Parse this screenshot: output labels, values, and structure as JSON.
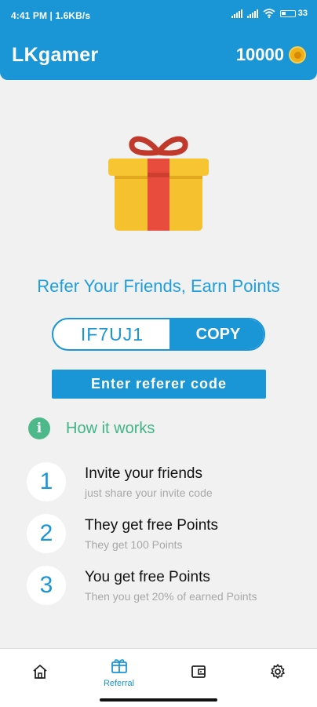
{
  "status_bar": {
    "time": "4:41 PM | 1.6KB/s",
    "battery": "33"
  },
  "app_bar": {
    "title": "LKgamer",
    "points": "10000",
    "coin_icon": "coin-icon"
  },
  "referral": {
    "headline": "Refer Your Friends, Earn Points",
    "code": "IF7UJ1",
    "copy_label": "COPY",
    "enter_referer_label": "Enter referer code"
  },
  "how_it_works": {
    "label": "How it works",
    "steps": [
      {
        "number": "1",
        "title": "Invite your friends",
        "subtitle": "just share your invite code"
      },
      {
        "number": "2",
        "title": "They get free Points",
        "subtitle": "They get 100 Points"
      },
      {
        "number": "3",
        "title": "You get free Points",
        "subtitle": "Then you get 20% of earned Points"
      }
    ]
  },
  "bottom_nav": {
    "items": [
      {
        "icon": "home-icon",
        "label": ""
      },
      {
        "icon": "referral-icon",
        "label": "Referral"
      },
      {
        "icon": "wallet-icon",
        "label": ""
      },
      {
        "icon": "settings-icon",
        "label": ""
      }
    ],
    "active_color": "#1a95d6"
  },
  "colors": {
    "primary": "#1a95d6",
    "accent_green": "#4db88a",
    "background": "#f1f1f1"
  }
}
